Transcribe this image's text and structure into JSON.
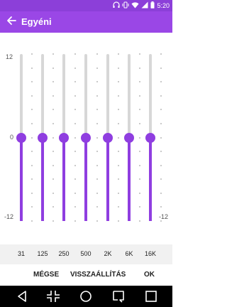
{
  "status_bar": {
    "time": "5:20",
    "icons": [
      "headphones-icon",
      "vibrate-icon",
      "wifi-icon",
      "signal-icon",
      "battery-icon"
    ]
  },
  "app_bar": {
    "title": "Egyéni",
    "back_icon": "back-arrow-icon"
  },
  "equalizer": {
    "scale_top": "12",
    "scale_middle": "0",
    "scale_bottom": "-12",
    "range_db": [
      -12,
      12
    ],
    "bands": [
      {
        "label": "31",
        "value": 0
      },
      {
        "label": "125",
        "value": 0
      },
      {
        "label": "250",
        "value": 0
      },
      {
        "label": "500",
        "value": 0
      },
      {
        "label": "2K",
        "value": 0
      },
      {
        "label": "6K",
        "value": 0
      },
      {
        "label": "16K",
        "value": 0
      }
    ]
  },
  "actions": {
    "cancel": "MÉGSE",
    "reset": "VISSZAÁLLÍTÁS",
    "ok": "OK"
  },
  "navigation_bar": {
    "icons": [
      "back-triangle-icon",
      "collapse-icon",
      "home-circle-icon",
      "capture-icon",
      "recents-square-icon"
    ]
  },
  "colors": {
    "accent": "#8f3ee0",
    "app_bar": "#9a47e6",
    "status_bar": "#8c3fd9",
    "track": "#d7d7d7"
  }
}
